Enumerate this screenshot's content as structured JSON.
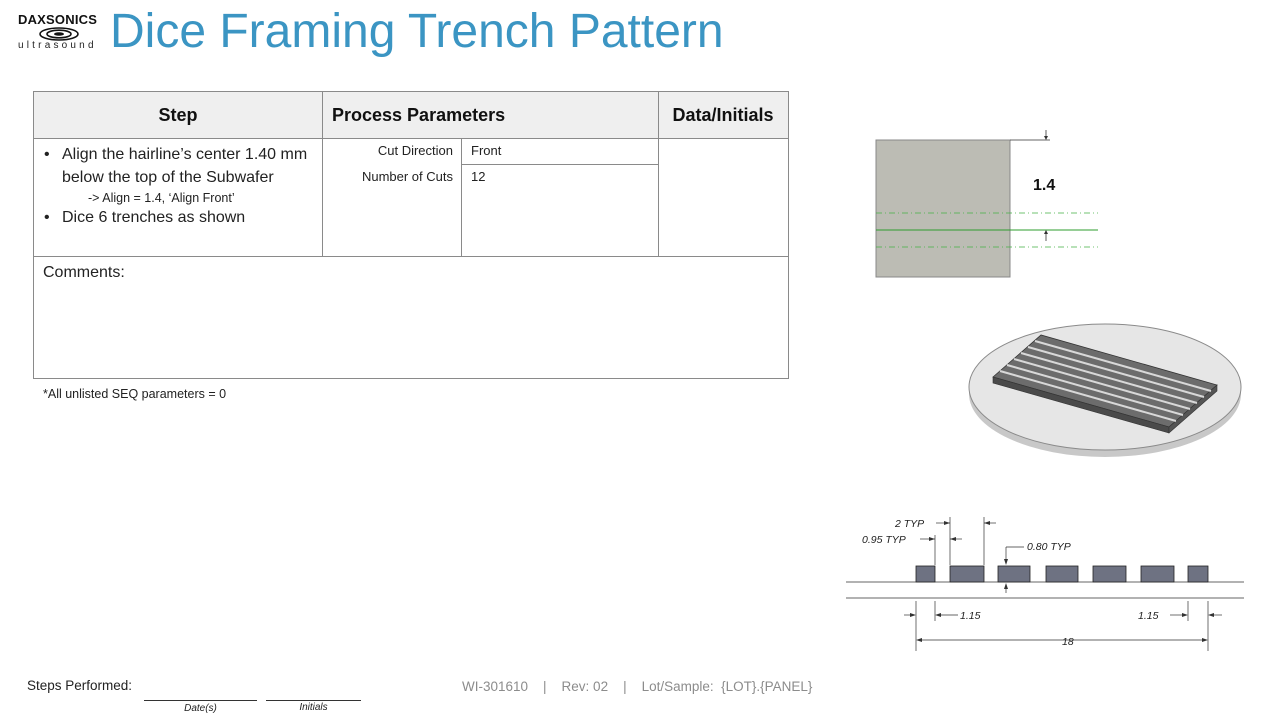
{
  "logo": {
    "brand": "DAXSONICS",
    "sub": "ultrasound"
  },
  "title": "Dice Framing Trench Pattern",
  "table": {
    "headers": {
      "step": "Step",
      "params": "Process Parameters",
      "data": "Data/Initials"
    },
    "steps": {
      "bullet1": "Align the hairline’s center 1.40 mm below the top of the Subwafer",
      "note": "-> Align = 1.4, ‘Align Front’",
      "bullet2": "Dice 6 trenches as shown"
    },
    "params": [
      {
        "label": "Cut Direction",
        "value": "Front"
      },
      {
        "label": "Number of Cuts",
        "value": "12"
      }
    ],
    "comments_label": "Comments:"
  },
  "footnote": "*All unlisted SEQ parameters = 0",
  "figures": {
    "align_value": "1.4",
    "dim_2typ": "2 TYP",
    "dim_095typ": "0.95 TYP",
    "dim_080typ": "0.80 TYP",
    "dim_115_left": "1.15",
    "dim_115_right": "1.15",
    "dim_18": "18"
  },
  "footer": {
    "steps_performed": "Steps Performed:",
    "dates_caption": "Date(s)",
    "initials_caption": "Initials",
    "doc_info": "WI-301610    |    Rev: 02    |    Lot/Sample:  {LOT}.{PANEL}"
  }
}
